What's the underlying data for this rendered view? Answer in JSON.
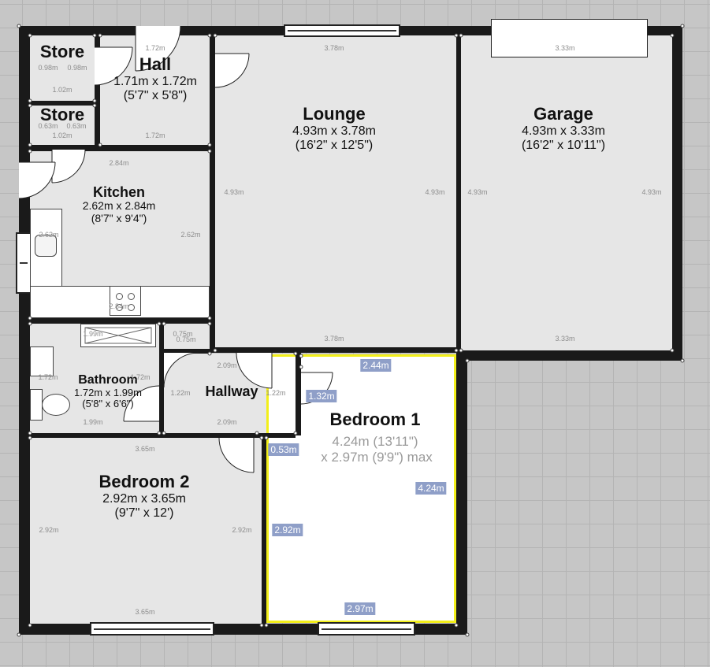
{
  "rooms": {
    "store1": {
      "name": "Store"
    },
    "store2": {
      "name": "Store"
    },
    "hall": {
      "name": "Hall",
      "size_m": "1.71m x 1.72m",
      "size_ft": "(5'7\" x 5'8\")"
    },
    "lounge": {
      "name": "Lounge",
      "size_m": "4.93m x 3.78m",
      "size_ft": "(16'2\" x 12'5\")"
    },
    "garage": {
      "name": "Garage",
      "size_m": "4.93m x 3.33m",
      "size_ft": "(16'2\" x 10'11\")"
    },
    "kitchen": {
      "name": "Kitchen",
      "size_m": "2.62m x 2.84m",
      "size_ft": "(8'7\" x 9'4\")"
    },
    "bathroom": {
      "name": "Bathroom",
      "size_m": "1.72m x 1.99m",
      "size_ft": "(5'8\" x 6'6\")"
    },
    "hallway": {
      "name": "Hallway"
    },
    "bedroom1": {
      "name": "Bedroom 1",
      "size_line1": "4.24m (13'11\")",
      "size_line2": "x 2.97m (9'9\") max"
    },
    "bedroom2": {
      "name": "Bedroom 2",
      "size_m": "2.92m x 3.65m",
      "size_ft": "(9'7\" x 12')"
    }
  },
  "dimensions": {
    "store1_a": "0.98m",
    "store1_b": "0.98m",
    "store1_w": "1.02m",
    "store2_a": "0.63m",
    "store2_b": "0.63m",
    "store2_w": "1.02m",
    "hall_top": "1.72m",
    "hall_bottom": "1.72m",
    "lounge_top": "3.78m",
    "lounge_left": "4.93m",
    "lounge_right": "4.93m",
    "lounge_bottom": "3.78m",
    "garage_top": "3.33m",
    "garage_left": "4.93m",
    "garage_right": "4.93m",
    "garage_bottom": "3.33m",
    "kitchen_top": "2.84m",
    "kitchen_left": "2.62m",
    "kitchen_right": "2.62m",
    "kitchen_bottom": "2.84m",
    "bath_top": "1.99m",
    "bath_left": "1.72m",
    "bath_right": "1.72m",
    "bath_bottom": "1.99m",
    "hallway_top": "2.09m",
    "hallway_bottom": "2.09m",
    "hallway_right": "1.22m",
    "hallway_left": "1.22m",
    "closet_a": "0.75m",
    "closet_b": "0.75m",
    "bed2_top": "3.65m",
    "bed2_left": "2.92m",
    "bed2_right": "2.92m",
    "bed2_bottom": "3.65m"
  },
  "bedroom1_tags": {
    "top": "2.44m",
    "notch_left": "1.32m",
    "notch_step": "0.53m",
    "right": "4.24m",
    "left": "2.92m",
    "bottom": "2.97m"
  },
  "colors": {
    "wall": "#1a1a1a",
    "room_fill": "#e6e6e6",
    "selection": "#f2ef1a",
    "dim_tag": "#8f9fc8",
    "grid": "#c6c6c6"
  }
}
